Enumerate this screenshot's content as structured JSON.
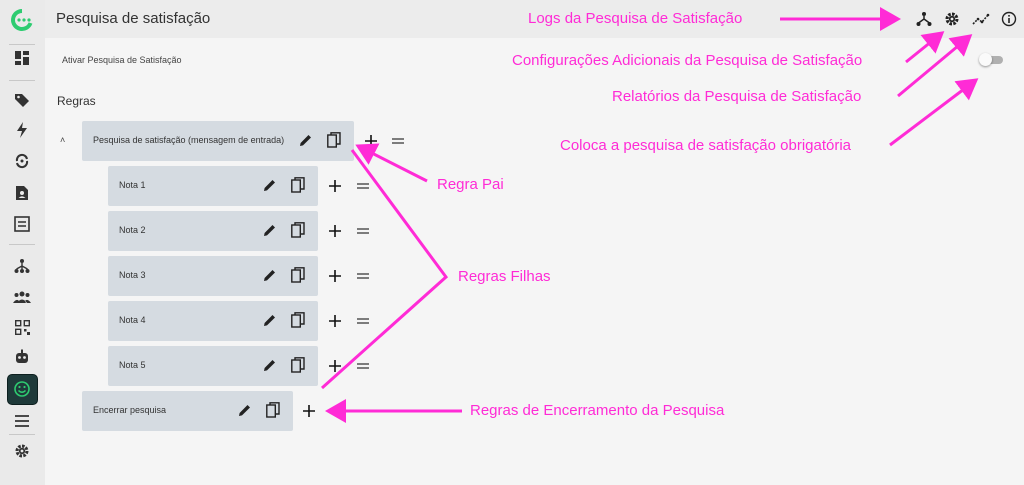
{
  "header": {
    "title": "Pesquisa de satisfação"
  },
  "header_icons": [
    "logs-icon",
    "settings-icon",
    "reports-icon",
    "info-icon"
  ],
  "sidebar": {
    "icons": [
      "dashboard-icon",
      "tag-icon",
      "bolt-icon",
      "sync-icon",
      "contact-icon",
      "task-icon",
      "flow-icon",
      "team-icon",
      "qr-icon",
      "bot-icon",
      "satisfaction-icon",
      "menu-icon",
      "settings-icon"
    ],
    "active": "satisfaction-icon"
  },
  "toggle": {
    "label": "Ativar Pesquisa de Satisfação",
    "checked": false
  },
  "rules": {
    "title": "Regras",
    "collapse_symbol": "˄",
    "parent": {
      "label": "Pesquisa de satisfação (mensagem de entrada)"
    },
    "children": [
      {
        "label": "Nota 1"
      },
      {
        "label": "Nota 2"
      },
      {
        "label": "Nota 3"
      },
      {
        "label": "Nota 4"
      },
      {
        "label": "Nota 5"
      }
    ],
    "closing": {
      "label": "Encerrar pesquisa"
    }
  },
  "annotations": {
    "logs": "Logs da Pesquisa de Satisfação",
    "settings": "Configurações Adicionais da Pesquisa de Satisfação",
    "reports": "Relatórios da Pesquisa de Satisfação",
    "toggle": "Coloca a pesquisa de satisfação obrigatória",
    "parent": "Regra Pai",
    "children": "Regras Filhas",
    "closing": "Regras de Encerramento da Pesquisa"
  },
  "colors": {
    "annotation": "#ff2bd6",
    "rule_bg": "#d5dbe1",
    "brand": "#2ecc71",
    "active_bg": "#1f3a3a"
  }
}
